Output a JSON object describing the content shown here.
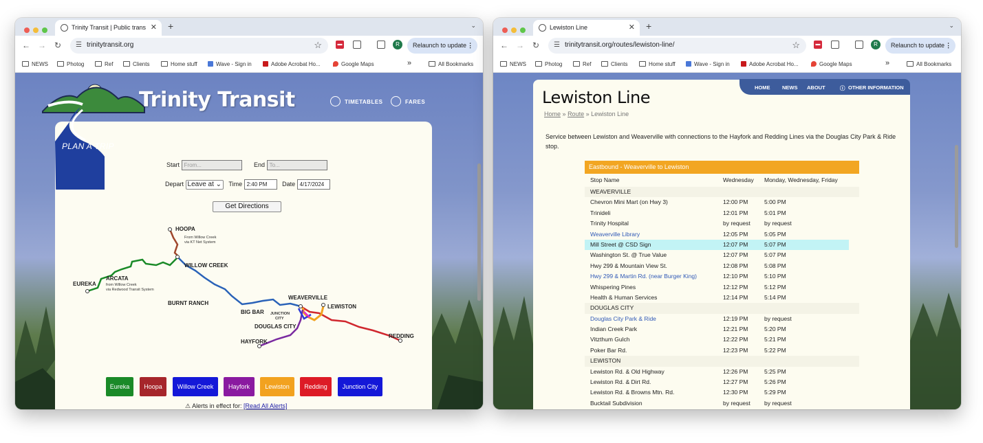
{
  "left_window": {
    "tab_title": "Trinity Transit | Public transpo",
    "url": "trinitytransit.org",
    "relaunch": "Relaunch to update",
    "avatar_letter": "R",
    "bookmarks": [
      "NEWS",
      "Photog",
      "Ref",
      "Clients",
      "Home stuff",
      "Wave - Sign in",
      "Adobe Acrobat Ho...",
      "Google Maps"
    ],
    "all_bookmarks": "All Bookmarks",
    "overflow": "»",
    "page": {
      "logo": "Trinity Transit",
      "nav": [
        "TIMETABLES",
        "FARES"
      ],
      "plan_trip": "PLAN A TRIP",
      "start_label": "Start",
      "start_placeholder": "From...",
      "end_label": "End",
      "end_placeholder": "To...",
      "depart_label": "Depart",
      "depart_value": "Leave at",
      "time_label": "Time",
      "time_value": "2:40 PM",
      "date_label": "Date",
      "date_value": "4/17/2024",
      "get_directions": "Get Directions",
      "map_labels": {
        "hoopa": "HOOPA",
        "hoopa_note1": "From Willow Creek",
        "hoopa_note2": "via KT Net System",
        "willow_creek": "WILLOW CREEK",
        "eureka": "EUREKA",
        "arcata": "ARCATA",
        "arcata_note1": "from Willow Creek",
        "arcata_note2": "via Redwood Transit System",
        "burnt_ranch": "BURNT RANCH",
        "weaverville": "WEAVERVILLE",
        "lewiston": "LEWISTON",
        "big_bar": "BIG BAR",
        "junction": "JUNCTION",
        "city": "CITY",
        "douglas_city": "DOUGLAS CITY",
        "hayfork": "HAYFORK",
        "redding": "REDDING"
      },
      "routes": [
        {
          "label": "Eureka",
          "color": "#1a8a28"
        },
        {
          "label": "Hoopa",
          "color": "#a6262b"
        },
        {
          "label": "Willow Creek",
          "color": "#1418d8"
        },
        {
          "label": "Hayfork",
          "color": "#8a1aa0"
        },
        {
          "label": "Lewiston",
          "color": "#f2a21f"
        },
        {
          "label": "Redding",
          "color": "#dd1b26"
        },
        {
          "label": "Junction City",
          "color": "#1418d8"
        }
      ],
      "alerts_text": "Alerts in effect for:",
      "alerts_link": "[Read All Alerts]"
    }
  },
  "right_window": {
    "tab_title": "Lewiston Line",
    "url": "trinitytransit.org/routes/lewiston-line/",
    "relaunch": "Relaunch to update",
    "avatar_letter": "R",
    "bookmarks": [
      "NEWS",
      "Photog",
      "Ref",
      "Clients",
      "Home stuff",
      "Wave - Sign in",
      "Adobe Acrobat Ho...",
      "Google Maps"
    ],
    "all_bookmarks": "All Bookmarks",
    "overflow": "»",
    "page": {
      "nav": [
        "HOME",
        "NEWS",
        "ABOUT",
        "OTHER INFORMATION"
      ],
      "title": "Lewiston Line",
      "breadcrumb": {
        "home": "Home",
        "sep": "»",
        "route": "Route",
        "current": "Lewiston Line"
      },
      "intro": "Service between Lewiston and Weaverville with connections to the Hayfork and Redding Lines via the Douglas City Park & Ride stop.",
      "schedule_title": "Eastbound - Weaverville to Lewiston",
      "columns": [
        "Stop Name",
        "Wednesday",
        "Monday, Wednesday, Friday"
      ],
      "rows": [
        {
          "type": "section",
          "stop": "WEAVERVILLE"
        },
        {
          "stop": "Chevron Mini Mart (on Hwy 3)",
          "wed": "12:00 PM",
          "mwf": "5:00 PM"
        },
        {
          "stop": "Trinideli",
          "wed": "12:01 PM",
          "mwf": "5:01 PM"
        },
        {
          "stop": "Trinity Hospital",
          "wed": "by request",
          "mwf": "by request"
        },
        {
          "stop": "Weaverville Library",
          "wed": "12:05 PM",
          "mwf": "5:05 PM",
          "link": true
        },
        {
          "stop": "Mill Street @ CSD Sign",
          "wed": "12:07 PM",
          "mwf": "5:07 PM",
          "highlight": true
        },
        {
          "stop": "Washington St. @ True Value",
          "wed": "12:07 PM",
          "mwf": "5:07 PM"
        },
        {
          "stop": "Hwy 299 & Mountain View St.",
          "wed": "12:08 PM",
          "mwf": "5:08 PM"
        },
        {
          "stop": "Hwy 299 & Martin Rd. (near Burger King)",
          "wed": "12:10 PM",
          "mwf": "5:10 PM",
          "link": true
        },
        {
          "stop": "Whispering Pines",
          "wed": "12:12 PM",
          "mwf": "5:12 PM"
        },
        {
          "stop": "Health & Human Services",
          "wed": "12:14 PM",
          "mwf": "5:14 PM"
        },
        {
          "type": "section",
          "stop": "DOUGLAS CITY"
        },
        {
          "stop": "Douglas City Park & Ride",
          "wed": "12:19 PM",
          "mwf": "by request",
          "link": true
        },
        {
          "stop": "Indian Creek Park",
          "wed": "12:21 PM",
          "mwf": "5:20 PM"
        },
        {
          "stop": "Vitzthum Gulch",
          "wed": "12:22 PM",
          "mwf": "5:21 PM"
        },
        {
          "stop": "Poker Bar Rd.",
          "wed": "12:23 PM",
          "mwf": "5:22 PM"
        },
        {
          "type": "section",
          "stop": "LEWISTON"
        },
        {
          "stop": "Lewiston Rd. & Old Highway",
          "wed": "12:26 PM",
          "mwf": "5:25 PM"
        },
        {
          "stop": "Lewiston Rd. & Dirt Rd.",
          "wed": "12:27 PM",
          "mwf": "5:26 PM"
        },
        {
          "stop": "Lewiston Rd. & Browns Mtn. Rd.",
          "wed": "12:30 PM",
          "mwf": "5:29 PM"
        },
        {
          "stop": "Bucktail Subdivision",
          "wed": "by request",
          "mwf": "by request"
        }
      ]
    }
  }
}
